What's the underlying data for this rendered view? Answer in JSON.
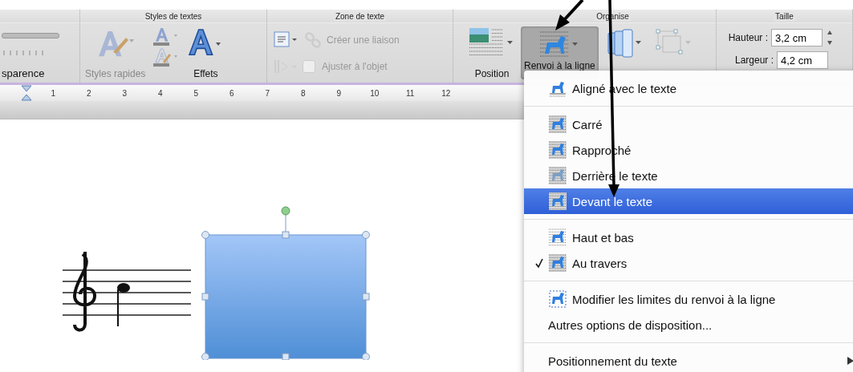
{
  "ribbon": {
    "groups": [
      {
        "kind": "transparency",
        "label": "sparence"
      },
      {
        "kind": "text-styles",
        "title": "Styles de textes",
        "quick_styles": "Styles rapides",
        "effects": "Effets"
      },
      {
        "kind": "text-box",
        "title": "Zone de texte",
        "link": {
          "label": "Créer une liaison",
          "disabled": true
        },
        "fit": {
          "label": "Ajuster à l'objet",
          "checked": false,
          "disabled": true
        }
      },
      {
        "kind": "arrange",
        "title": "Organise",
        "position": "Position",
        "wrap": {
          "label": "Renvoi à la ligne",
          "selected": true
        }
      },
      {
        "kind": "size",
        "title": "Taille",
        "height": {
          "label": "Hauteur :",
          "value": "3,2 cm"
        },
        "width": {
          "label": "Largeur :",
          "value": "4,2 cm"
        }
      }
    ]
  },
  "ruler": {
    "numbers": [
      "1",
      "2",
      "3",
      "4",
      "5",
      "6",
      "7",
      "8",
      "9",
      "10",
      "11",
      "12"
    ]
  },
  "menu": {
    "items": [
      {
        "kind": "item",
        "label": "Aligné avec le texte",
        "selected": false,
        "checked": false
      },
      {
        "kind": "separator"
      },
      {
        "kind": "item",
        "label": "Carré",
        "selected": false,
        "checked": false
      },
      {
        "kind": "item",
        "label": "Rapproché",
        "selected": false,
        "checked": false
      },
      {
        "kind": "item",
        "label": "Derrière le texte",
        "selected": false,
        "checked": false
      },
      {
        "kind": "item",
        "label": "Devant le texte",
        "selected": true,
        "checked": false
      },
      {
        "kind": "separator"
      },
      {
        "kind": "item",
        "label": "Haut et bas",
        "selected": false,
        "checked": false
      },
      {
        "kind": "item",
        "label": "Au travers",
        "selected": false,
        "checked": true
      },
      {
        "kind": "separator"
      },
      {
        "kind": "item",
        "label": "Modifier les limites du renvoi à la ligne",
        "selected": false,
        "checked": false
      },
      {
        "kind": "item",
        "label": "Autres options de disposition...",
        "selected": false,
        "checked": false
      },
      {
        "kind": "separator"
      },
      {
        "kind": "submenu",
        "label": "Positionnement du texte",
        "selected": false
      }
    ]
  }
}
